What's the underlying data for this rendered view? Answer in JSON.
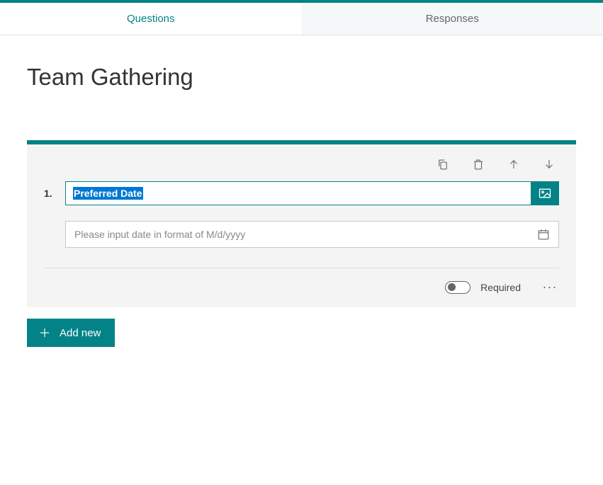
{
  "tabs": {
    "questions": "Questions",
    "responses": "Responses"
  },
  "form": {
    "title": "Team Gathering"
  },
  "question": {
    "number": "1.",
    "text": "Preferred Date",
    "date_placeholder": "Please input date in format of M/d/yyyy",
    "required_label": "Required"
  },
  "buttons": {
    "add_new": "Add new"
  }
}
